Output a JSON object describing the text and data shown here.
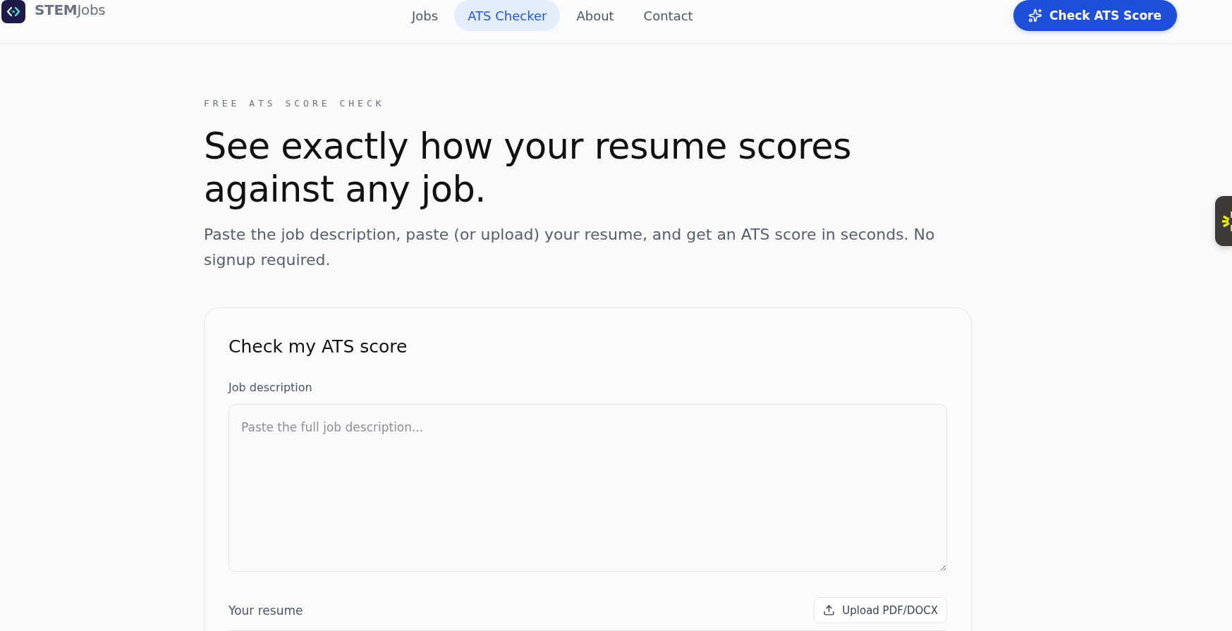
{
  "header": {
    "logo": {
      "text": "**STEM**Jobs"
    },
    "nav": [
      {
        "label": "Jobs",
        "selected": false
      },
      {
        "label": "ATS Checker",
        "selected": true
      },
      {
        "label": "About",
        "selected": false
      },
      {
        "label": "Contact",
        "selected": false
      }
    ],
    "cta_button": {
      "label": "Check ATS Score"
    }
  },
  "hero": {
    "eyebrow": "FREE ATS SCORE CHECK",
    "title": "See exactly how your resume scores against any job.",
    "subtitle": "Paste the job description, paste (or upload) your resume, and get an ATS score in seconds. No signup required."
  },
  "form": {
    "title": "Check my ATS score",
    "job_description": {
      "label": "Job description",
      "placeholder": "Paste the full job description..."
    },
    "resume": {
      "label": "Your resume",
      "upload_button": "Upload PDF/DOCX"
    }
  }
}
